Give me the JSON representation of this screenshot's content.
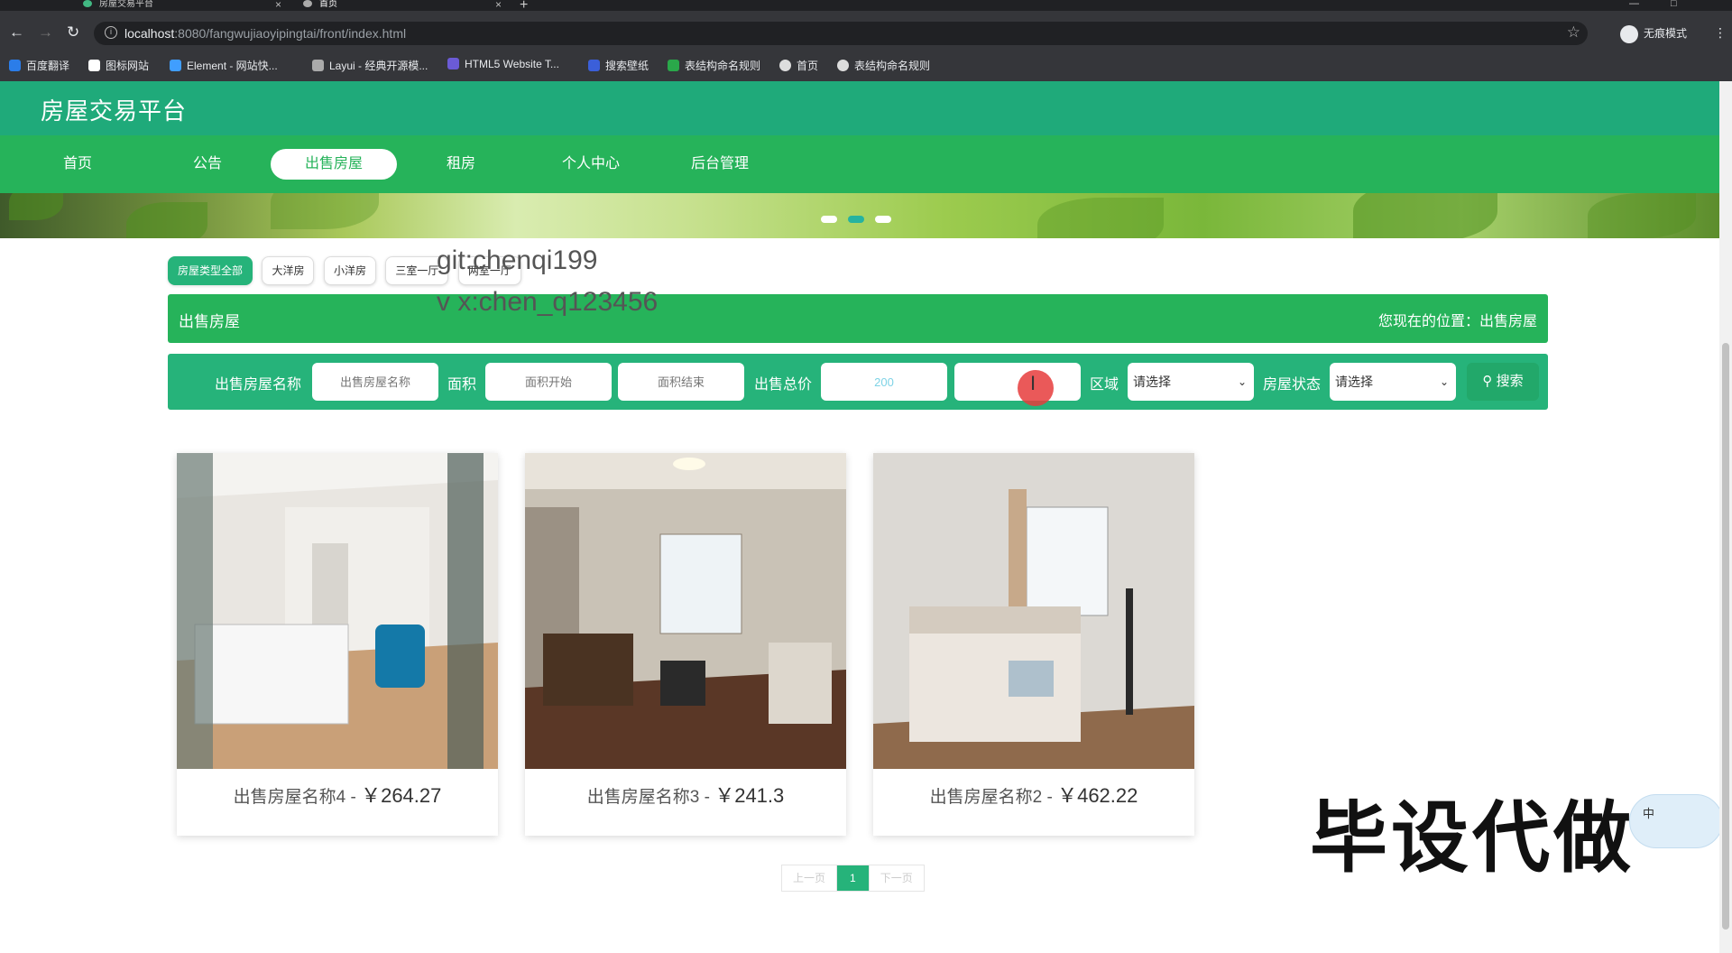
{
  "browser": {
    "tabs": [
      {
        "title": "房屋交易平台"
      },
      {
        "title": "首页"
      }
    ],
    "url_host": "localhost",
    "url_rest": ":8080/fangwujiaoyipingtai/front/index.html",
    "profile_label": "无痕模式",
    "bookmarks": [
      "百度翻译",
      "图标网站",
      "Element - 网站快...",
      "Layui - 经典开源模...",
      "HTML5 Website T...",
      "搜索壁纸",
      "表结构命名规则",
      "首页",
      "表结构命名规则"
    ]
  },
  "site": {
    "logo": "房屋交易平台",
    "nav": [
      "首页",
      "公告",
      "出售房屋",
      "租房",
      "个人中心",
      "后台管理"
    ],
    "active_nav": "出售房屋"
  },
  "types": [
    "房屋类型全部",
    "大洋房",
    "小洋房",
    "三室一厅",
    "两室一厅"
  ],
  "overlay": {
    "line1": "git:chenqi199",
    "line2": "v x:chen_q123456",
    "big": "毕设代做",
    "ime": "中"
  },
  "crumb": {
    "title": "出售房屋",
    "location": "您现在的位置：出售房屋"
  },
  "search": {
    "name_label": "出售房屋名称",
    "name_placeholder": "出售房屋名称",
    "area_label": "面积",
    "area_start_placeholder": "面积开始",
    "area_end_placeholder": "面积结束",
    "price_label": "出售总价",
    "price_start_value": "200",
    "price_end_value": "",
    "region_label": "区域",
    "region_value": "请选择",
    "status_label": "房屋状态",
    "status_value": "请选择",
    "search_button": "搜索"
  },
  "listings": [
    {
      "name": "出售房屋名称4",
      "sep": " - ",
      "price": "￥264.27"
    },
    {
      "name": "出售房屋名称3",
      "sep": " - ",
      "price": "￥241.3"
    },
    {
      "name": "出售房屋名称2",
      "sep": " - ",
      "price": "￥462.22"
    }
  ],
  "pager": {
    "prev": "上一页",
    "current": "1",
    "next": "下一页"
  },
  "colors": {
    "header": "#1faa7a",
    "nav": "#26b35a",
    "accent": "#26b37a"
  }
}
